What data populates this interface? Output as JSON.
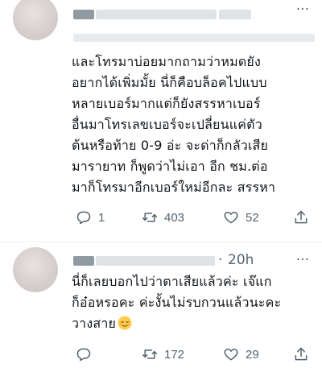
{
  "tweet1": {
    "lines": [
      "และโทรมาบ่อยมากถามว่าหมดยัง",
      "อยากได้เพิ่มมั้ย นี่ก็คือบล็อคไปแบบ",
      "หลายเบอร์มากแต่ก็ยังสรรหาเบอร์",
      "อื่นมาโทรเลขเบอร์จะเปลี่ยนแค่ตัว",
      "ต้นหรือท้าย 0-9 อ่ะ จะด่าก็กลัวเสีย",
      "มารายาท ก็พูดว่าไม่เอา อีก ชม.ต่อ",
      "มาก็โทรมาอีกเบอร์ใหม่อีกละ สรรหา"
    ],
    "reply_count": "1",
    "retweet_count": "403",
    "like_count": "52"
  },
  "tweet2": {
    "time": "20h",
    "separator": "·",
    "more": "···",
    "lines": [
      "นี่ก็เลยบอกไปว่าตาเสียแล้วค่ะ เจ๊แก",
      "ก็อ๋อหรอคะ ค่ะงั้นไม่รบกวนแล้วนะคะ",
      "วางสาย"
    ],
    "emoji": "relieved-face",
    "reply_count": "",
    "retweet_count": "172",
    "like_count": "29"
  },
  "colors": {
    "text": "#0f1419",
    "muted": "#536471",
    "divider": "#eff3f4"
  }
}
